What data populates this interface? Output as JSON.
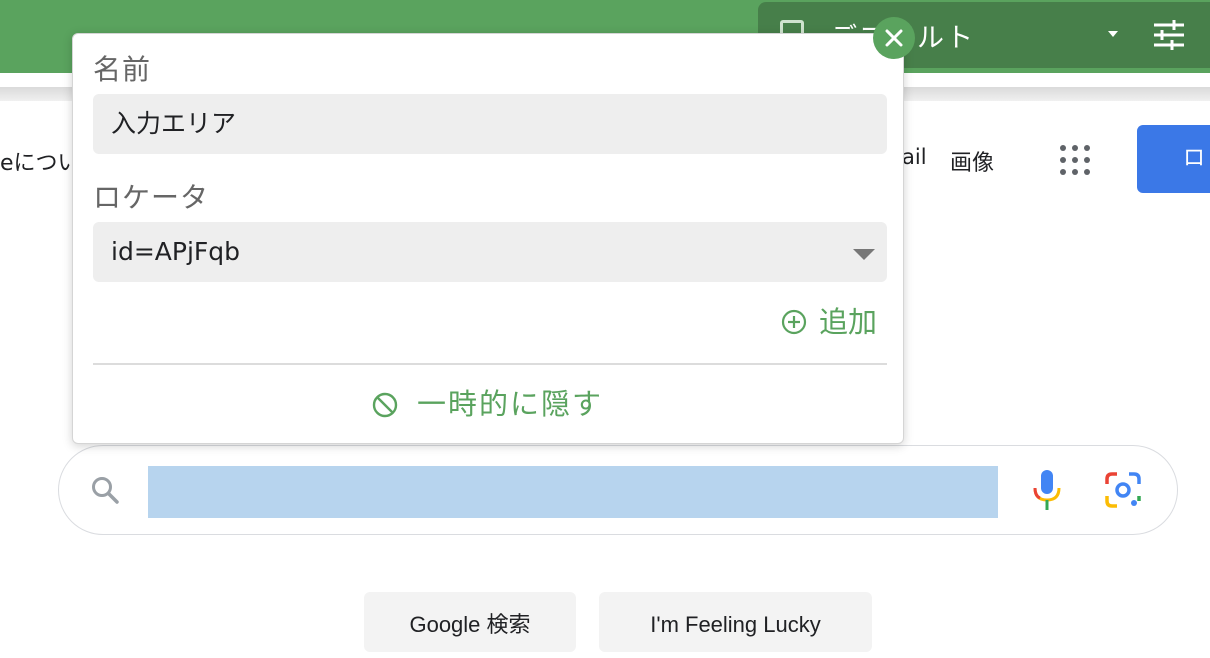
{
  "colors": {
    "accent": "#5aa35e",
    "accent_dark": "#477f4a",
    "primary_blue": "#3b78e7",
    "field_bg": "#eeeeee",
    "search_selection": "#b7d4ee"
  },
  "extension_bar": {
    "profile_title": "デフォルト",
    "dropdown_icon": "caret-down-icon",
    "settings_icon": "sliders-icon"
  },
  "google_page": {
    "nav_left_text": "eについ",
    "gmail": "ail",
    "images": "画像",
    "apps_icon": "apps-grid-icon",
    "login_label": "ロ",
    "search": {
      "value": "",
      "icons": [
        "search-icon",
        "mic-icon",
        "lens-icon"
      ]
    },
    "buttons": {
      "search": "Google 検索",
      "lucky": "I'm Feeling Lucky"
    }
  },
  "popup": {
    "name_label": "名前",
    "name_value": "入力エリア",
    "locator_label": "ロケータ",
    "locator_value": "id=APjFqb",
    "add_label": "追加",
    "hide_label": "一時的に隠す",
    "close_icon": "close-icon"
  }
}
